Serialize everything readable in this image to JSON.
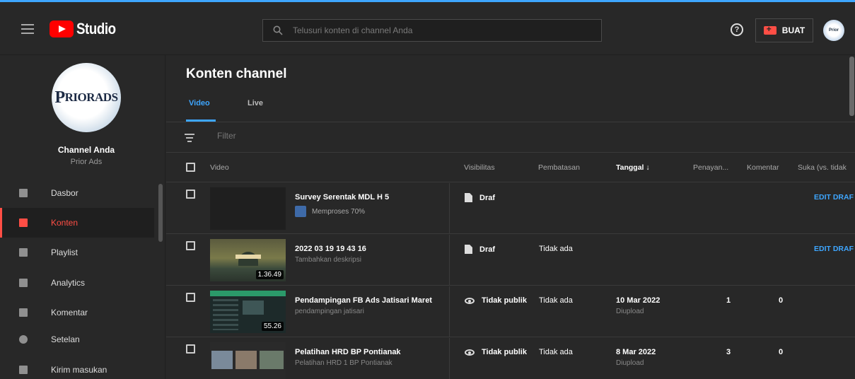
{
  "app": {
    "logo_text": "Studio"
  },
  "search": {
    "placeholder": "Telusuri konten di channel Anda"
  },
  "header": {
    "help_label": "?",
    "create_label": "BUAT",
    "avatar_label": "Prior"
  },
  "sidebar": {
    "channel_title": "Channel Anda",
    "channel_name": "Prior Ads",
    "avatar_text_p": "P",
    "avatar_text_rest": "RIORADS",
    "items": [
      {
        "label": "Dasbor",
        "icon": "dashboard-icon"
      },
      {
        "label": "Konten",
        "icon": "content-icon",
        "active": true
      },
      {
        "label": "Playlist",
        "icon": "playlist-icon"
      },
      {
        "label": "Analytics",
        "icon": "analytics-icon"
      },
      {
        "label": "Komentar",
        "icon": "comment-icon"
      },
      {
        "label": "Setelan",
        "icon": "gear-icon"
      },
      {
        "label": "Kirim masukan",
        "icon": "feedback-icon"
      }
    ]
  },
  "main": {
    "title": "Konten channel",
    "tabs": [
      {
        "label": "Video",
        "active": true
      },
      {
        "label": "Live"
      }
    ],
    "filter_placeholder": "Filter",
    "columns": {
      "video": "Video",
      "visibility": "Visibilitas",
      "restrictions": "Pembatasan",
      "date": "Tanggal ↓",
      "views": "Penayan...",
      "comments": "Komentar",
      "likes": "Suka (vs. tidak"
    },
    "rows": [
      {
        "title": "Survey Serentak MDL H 5",
        "processing": "Memproses 70%",
        "visibility": "Draf",
        "restriction": "",
        "date": "",
        "date_sub": "",
        "views": "",
        "comments": "",
        "action": "EDIT DRAF"
      },
      {
        "title": "2022 03 19 19 43 16",
        "description": "Tambahkan deskripsi",
        "duration": "1.36.49",
        "visibility": "Draf",
        "restriction": "Tidak ada",
        "date": "",
        "date_sub": "",
        "views": "",
        "comments": "",
        "action": "EDIT DRAF"
      },
      {
        "title": "Pendampingan FB Ads Jatisari Maret",
        "description": "pendampingan jatisari",
        "duration": "55.26",
        "visibility": "Tidak publik",
        "restriction": "Tidak ada",
        "date": "10 Mar 2022",
        "date_sub": "Diupload",
        "views": "1",
        "comments": "0",
        "action": ""
      },
      {
        "title": "Pelatihan HRD BP Pontianak",
        "description": "Pelatihan HRD 1 BP Pontianak",
        "duration": "",
        "visibility": "Tidak publik",
        "restriction": "Tidak ada",
        "date": "8 Mar 2022",
        "date_sub": "Diupload",
        "views": "3",
        "comments": "0",
        "action": ""
      }
    ]
  },
  "colors": {
    "accent": "#3ea6ff",
    "brand": "#ff0000",
    "active_nav": "#ff4e45",
    "background": "#282828"
  }
}
